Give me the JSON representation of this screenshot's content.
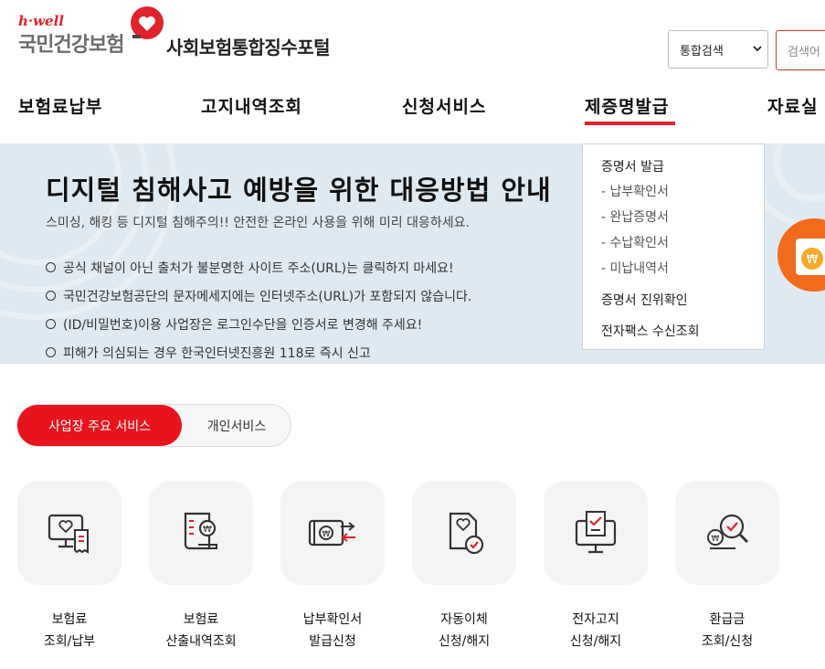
{
  "header": {
    "logo_brand": "h·well",
    "logo_org": "국민건강보험",
    "portal_title": "사회보험통합징수포털",
    "search_select_value": "통합검색",
    "search_placeholder": "검색어"
  },
  "nav": {
    "items": [
      "보험료납부",
      "고지내역조회",
      "신청서비스",
      "제증명발급",
      "자료실"
    ],
    "active": "제증명발급"
  },
  "dropdown": {
    "group1_title": "증명서 발급",
    "group1_items": [
      "- 납부확인서",
      "- 완납증명서",
      "- 수납확인서",
      "- 미납내역서"
    ],
    "item2": "증명서 진위확인",
    "item3": "전자팩스 수신조회"
  },
  "banner": {
    "title": "디지털 침해사고 예방을 위한 대응방법 안내",
    "subtitle": "스미싱, 해킹 등 디지털 침해주의!! 안전한 온라인 사용을 위해 미리 대응하세요.",
    "points": [
      "공식 채널이 아닌 출처가 불분명한 사이트 주소(URL)는 클릭하지 마세요!",
      "국민건강보험공단의 문자메세지에는 인터넷주소(URL)가 포함되지 않습니다.",
      "(ID/비밀번호)이용 사업장은 로그인수단을 인증서로 변경해 주세요!",
      "피해가 의심되는 경우 한국인터넷진흥원 118로 즉시 신고"
    ]
  },
  "tabs": {
    "active": "사업장 주요 서비스",
    "inactive": "개인서비스"
  },
  "services": [
    {
      "line1": "보험료",
      "line2": "조회/납부"
    },
    {
      "line1": "보험료",
      "line2": "산출내역조회"
    },
    {
      "line1": "납부확인서",
      "line2": "발급신청"
    },
    {
      "line1": "자동이체",
      "line2": "신청/해지"
    },
    {
      "line1": "전자고지",
      "line2": "신청/해지"
    },
    {
      "line1": "환급금",
      "line2": "조회/신청"
    }
  ],
  "colors": {
    "accent": "#e8141d",
    "banner_bg": "#dfe9f1",
    "tile_bg": "#f4f4f4"
  }
}
